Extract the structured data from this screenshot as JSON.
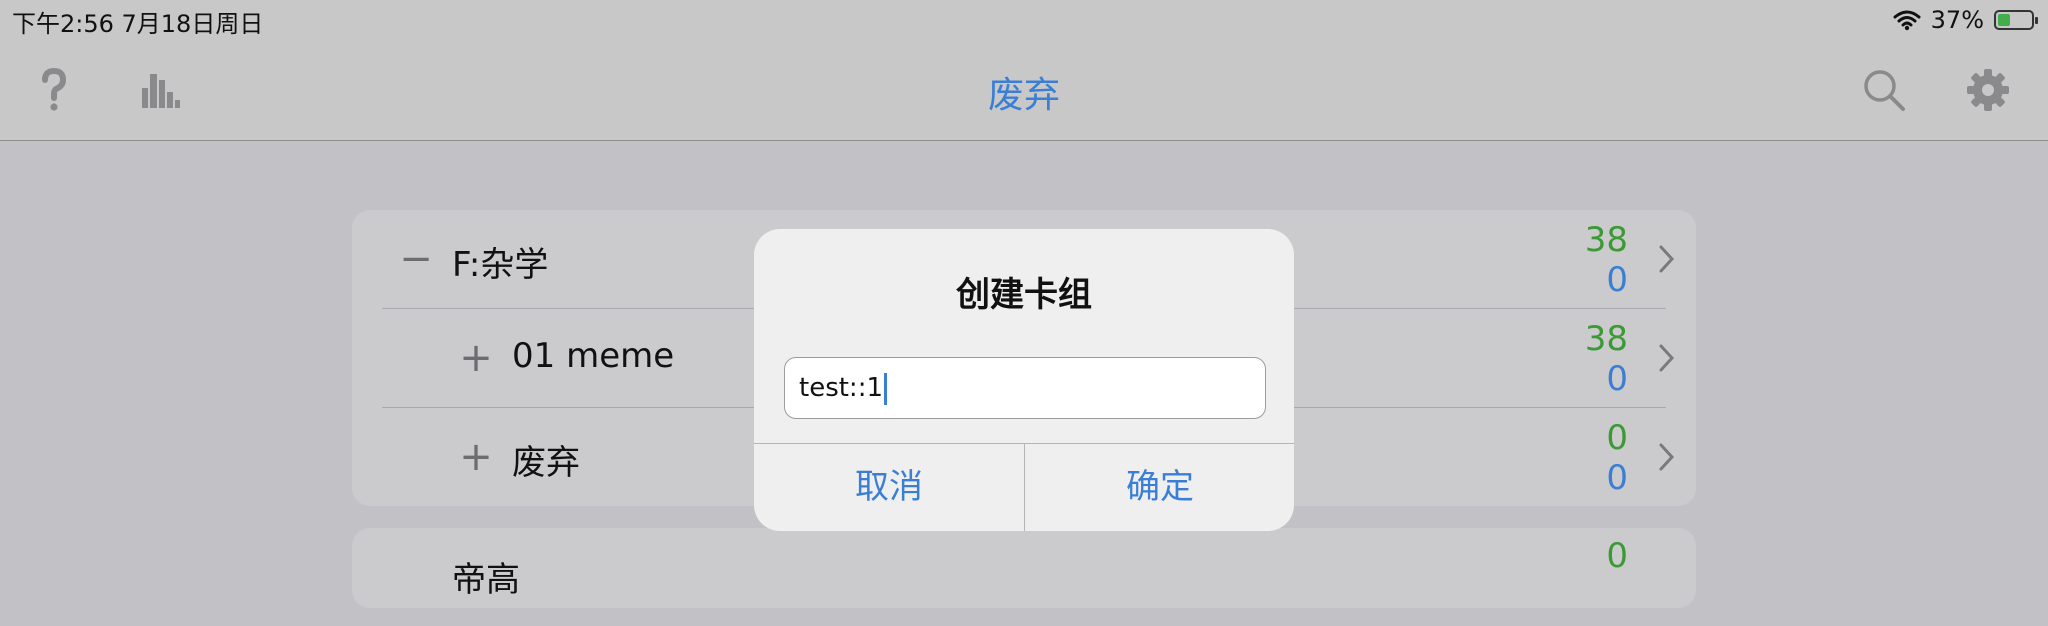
{
  "status_bar": {
    "time": "下午2:56   7月18日周日",
    "battery_percent": "37%",
    "battery_level": 0.37
  },
  "nav": {
    "title": "废弃",
    "icons": [
      "help-icon",
      "stats-icon",
      "search-icon",
      "gear-icon"
    ]
  },
  "decks": [
    {
      "toggle": "−",
      "name": "F:杂学",
      "count_a": "38",
      "count_b": "0"
    },
    {
      "toggle": "+",
      "name": "01 meme",
      "count_a": "38",
      "count_b": "0"
    },
    {
      "toggle": "+",
      "name": "废弃",
      "count_a": "0",
      "count_b": "0"
    },
    {
      "name": "帝高",
      "count_a": "0"
    }
  ],
  "dialog": {
    "title": "创建卡组",
    "input_value": "test::1",
    "cancel_label": "取消",
    "confirm_label": "确定"
  },
  "colors": {
    "accent": "#3b7fd5",
    "green_count": "#3c9a36",
    "background": "#c2c2c6"
  }
}
